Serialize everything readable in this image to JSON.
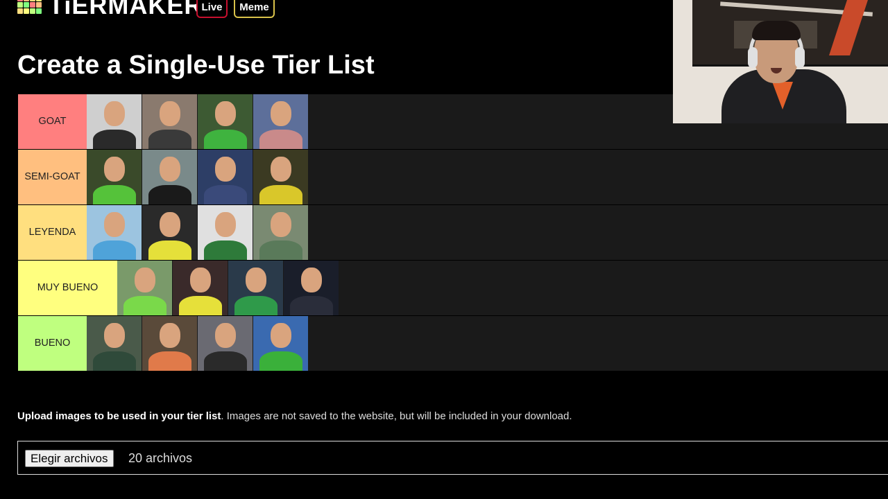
{
  "header": {
    "logo_text": "TiERMAKER",
    "logo_colors": [
      "#ff7f7f",
      "#ffbf7f",
      "#ffdf7f",
      "#ffff7f",
      "#bfff7f",
      "#7fff7f",
      "#ff7f7f",
      "#ffbf7f",
      "#ffdf7f",
      "#ffff7f",
      "#bfff7f",
      "#7fff7f"
    ],
    "nav": [
      {
        "label": "Live",
        "border_color": "#c8102e"
      },
      {
        "label": "Meme",
        "border_color": "#d9c24a"
      }
    ]
  },
  "page_title": "Create a Single-Use Tier List",
  "tiers": [
    {
      "label": "GOAT",
      "color": "#ff7f7f",
      "items": [
        {
          "name": "goalkeeper-photo",
          "bg": "#cfcfcf",
          "kit": "#2a2a2a"
        },
        {
          "name": "goalkeeper-photo",
          "bg": "#8a7a6e",
          "kit": "#3a3a3a"
        },
        {
          "name": "goalkeeper-photo",
          "bg": "#3d5a33",
          "kit": "#3fb33f"
        },
        {
          "name": "goalkeeper-photo",
          "bg": "#5d6f9a",
          "kit": "#c98a8a"
        }
      ]
    },
    {
      "label": "SEMI-GOAT",
      "color": "#ffbf7f",
      "items": [
        {
          "name": "goalkeeper-photo",
          "bg": "#3a4a2a",
          "kit": "#55c23a"
        },
        {
          "name": "goalkeeper-photo",
          "bg": "#7a8a8a",
          "kit": "#1a1a1a"
        },
        {
          "name": "goalkeeper-photo",
          "bg": "#2d3e66",
          "kit": "#3a4a7a"
        },
        {
          "name": "goalkeeper-photo",
          "bg": "#3b3a22",
          "kit": "#d9c72a"
        }
      ]
    },
    {
      "label": "LEYENDA",
      "color": "#ffdf7f",
      "items": [
        {
          "name": "goalkeeper-photo",
          "bg": "#9cc4e0",
          "kit": "#4fa3d9"
        },
        {
          "name": "goalkeeper-photo",
          "bg": "#2a2a2a",
          "kit": "#e5e03a"
        },
        {
          "name": "goalkeeper-photo",
          "bg": "#e0e0e0",
          "kit": "#2e7a3a"
        },
        {
          "name": "goalkeeper-photo",
          "bg": "#7a8a72",
          "kit": "#5a7a5a"
        }
      ]
    },
    {
      "label": "MUY BUENO",
      "color": "#ffff7f",
      "items": [
        {
          "name": "goalkeeper-photo",
          "bg": "#7a9a6a",
          "kit": "#7ad94a"
        },
        {
          "name": "goalkeeper-photo",
          "bg": "#3a2a2a",
          "kit": "#e6e03a"
        },
        {
          "name": "goalkeeper-photo",
          "bg": "#2a3a4a",
          "kit": "#2f9a4a"
        },
        {
          "name": "goalkeeper-photo",
          "bg": "#1a1e2a",
          "kit": "#2a2d3a"
        }
      ]
    },
    {
      "label": "BUENO",
      "color": "#bfff7f",
      "items": [
        {
          "name": "goalkeeper-photo",
          "bg": "#4a5a4a",
          "kit": "#2f4a3a"
        },
        {
          "name": "goalkeeper-photo",
          "bg": "#5a4a3a",
          "kit": "#e07a4a"
        },
        {
          "name": "goalkeeper-photo",
          "bg": "#6a6a72",
          "kit": "#2a2a2a"
        },
        {
          "name": "goalkeeper-photo",
          "bg": "#3a6ab0",
          "kit": "#3ab03a"
        }
      ]
    }
  ],
  "upload": {
    "bold_text": "Upload images to be used in your tier list",
    "rest_text": ". Images are not saved to the website, but will be included in your download.",
    "button_label": "Elegir archivos",
    "status": "20 archivos"
  }
}
